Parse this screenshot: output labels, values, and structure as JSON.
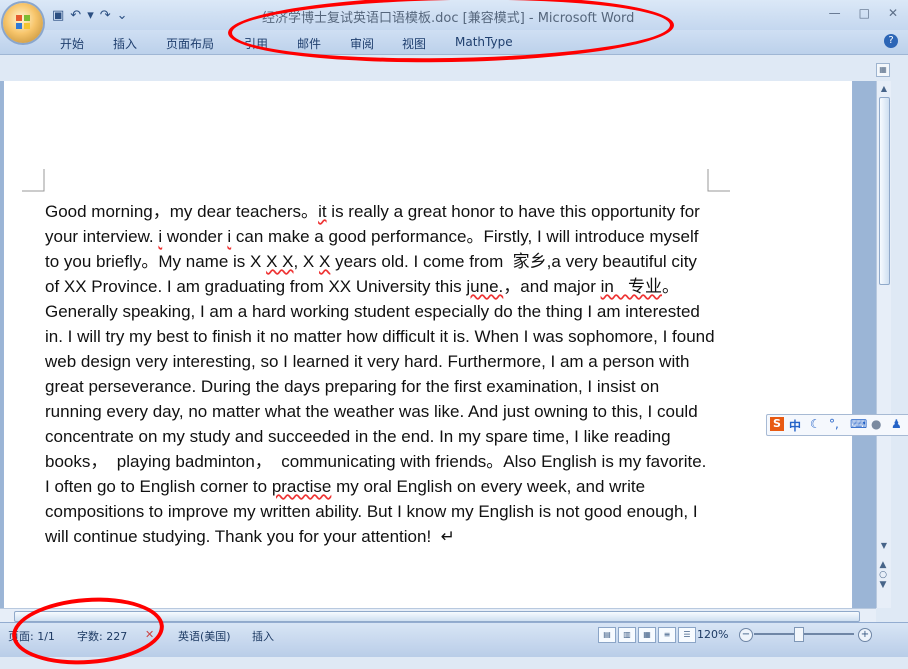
{
  "window": {
    "title": "经济学博士复试英语口语模板.doc [兼容模式] - Microsoft Word"
  },
  "ribbon": {
    "tabs": [
      "开始",
      "插入",
      "页面布局",
      "引用",
      "邮件",
      "审阅",
      "视图",
      "MathType"
    ]
  },
  "document": {
    "text_runs": [
      {
        "text": "Good morning，my dear teachers。",
        "wavy": false
      },
      {
        "text": "it",
        "wavy": true
      },
      {
        "text": " is really a great honor to have this opportunity for your interview. ",
        "wavy": false
      },
      {
        "text": "i",
        "wavy": true
      },
      {
        "text": " wonder ",
        "wavy": false
      },
      {
        "text": "i",
        "wavy": true
      },
      {
        "text": " can make a good performance。Firstly, I will introduce myself to you briefly。My name is X ",
        "wavy": false
      },
      {
        "text": "X X",
        "wavy": true
      },
      {
        "text": ", X ",
        "wavy": false
      },
      {
        "text": "X",
        "wavy": true
      },
      {
        "text": " years old. I come from  家乡,a very beautiful city of XX Province. I am graduating from XX University this ",
        "wavy": false
      },
      {
        "text": "june.",
        "wavy": true
      },
      {
        "text": "，and major ",
        "wavy": false
      },
      {
        "text": "in   专业",
        "wavy": true
      },
      {
        "text": "。Generally speaking, I am a hard working student especially do the thing I am interested in. I will try my best to finish it no matter how difficult it is. When I was sophomore, I found web design very interesting, so I learned it very hard. Furthermore, I am a person with great perseverance. During the days preparing for the first examination, I insist on running every day, no matter what the weather was like. And just owning to this, I could concentrate on my study and succeeded in the end. In my spare time, I like reading books，  playing badminton，  communicating with friends。Also English is my favorite. I often go to English corner to ",
        "wavy": false
      },
      {
        "text": "practise",
        "wavy": true
      },
      {
        "text": " my oral English on every week, and write compositions to improve my written ability. But I know my English is not good enough, I will continue studying. Thank you for your attention!  ↵",
        "wavy": false
      }
    ]
  },
  "statusbar": {
    "page": "页面: 1/1",
    "words": "字数: 227",
    "language": "英语(美国)",
    "mode": "插入",
    "zoom": "120%"
  },
  "ime": {
    "logo": "S",
    "mode": "中"
  },
  "colors": {
    "annotation": "#ff0000",
    "spellcheck": "#e33"
  }
}
